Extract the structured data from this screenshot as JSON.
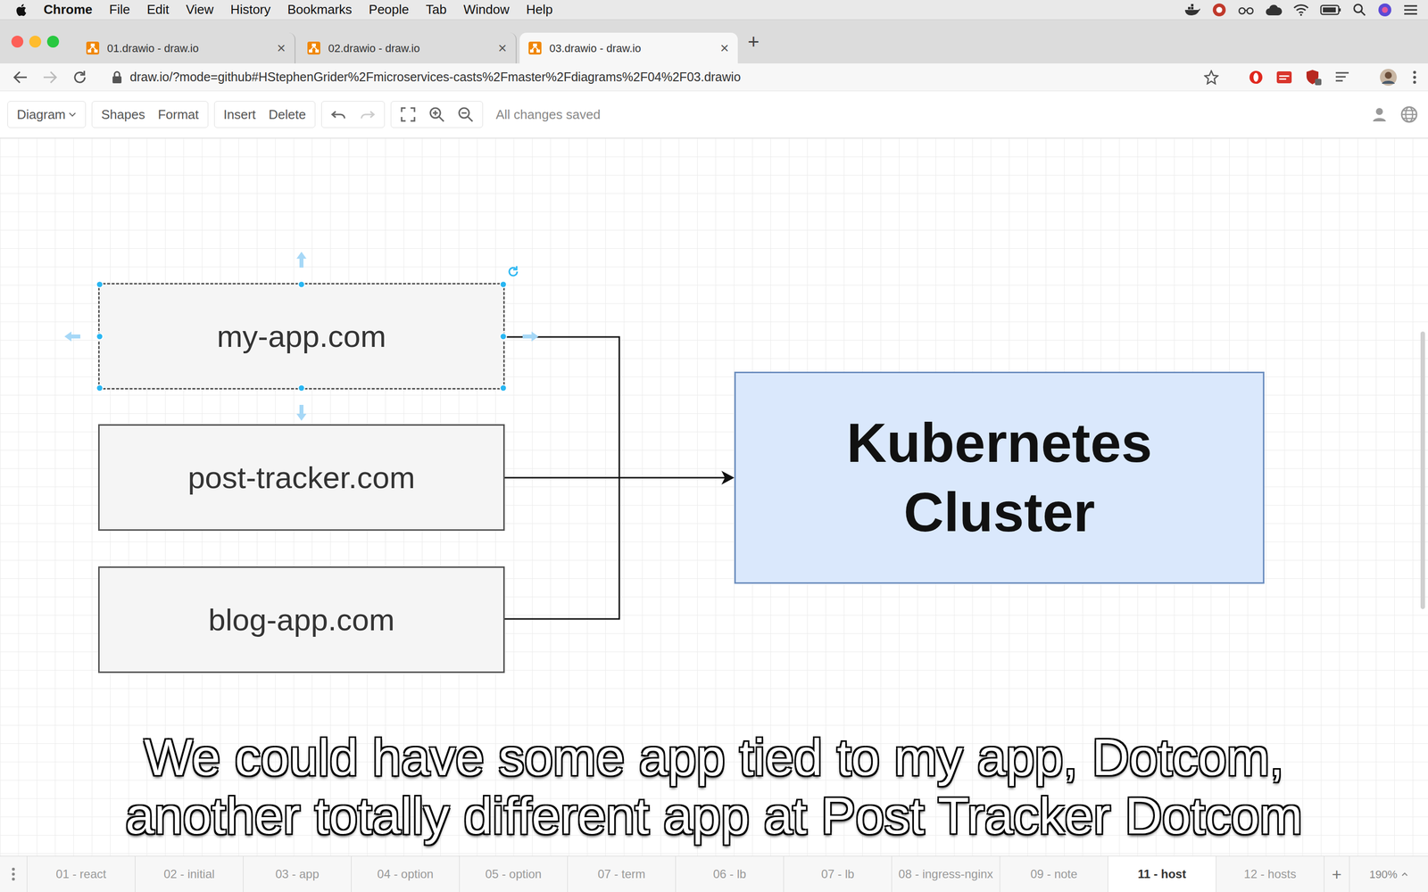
{
  "menu_bar": {
    "app": "Chrome",
    "items": [
      "File",
      "Edit",
      "View",
      "History",
      "Bookmarks",
      "People",
      "Tab",
      "Window",
      "Help"
    ]
  },
  "browser": {
    "tabs": [
      {
        "label": "01.drawio - draw.io",
        "selected": false
      },
      {
        "label": "02.drawio - draw.io",
        "selected": false
      },
      {
        "label": "03.drawio - draw.io",
        "selected": true
      }
    ],
    "tab_close": "×",
    "new_tab": "+",
    "url": "draw.io/?mode=github#HStephenGrider%2Fmicroservices-casts%2Fmaster%2Fdiagrams%2F04%2F03.drawio"
  },
  "toolbar": {
    "diagram_menu": "Diagram",
    "groups": [
      [
        "Shapes",
        "Format"
      ],
      [
        "Insert",
        "Delete"
      ]
    ],
    "history": [
      {
        "kind": "undo",
        "disabled": false
      },
      {
        "kind": "redo",
        "disabled": true
      }
    ],
    "status": "All changes saved"
  },
  "diagram": {
    "nodes": [
      {
        "label": "my-app.com",
        "selected": true
      },
      {
        "label": "post-tracker.com",
        "selected": false
      },
      {
        "label": "blog-app.com",
        "selected": false
      }
    ],
    "cluster": {
      "label": "Kubernetes Cluster"
    }
  },
  "subtitles": [
    "We could have some app tied to my app, Dotcom,",
    "another totally different app at Post Tracker Dotcom"
  ],
  "pages": {
    "tabs": [
      {
        "label": "01 - react",
        "selected": false
      },
      {
        "label": "02 - initial",
        "selected": false
      },
      {
        "label": "03 - app",
        "selected": false
      },
      {
        "label": "04 - option",
        "selected": false
      },
      {
        "label": "05 - option",
        "selected": false
      },
      {
        "label": "07 - term",
        "selected": false
      },
      {
        "label": "06 - lb",
        "selected": false
      },
      {
        "label": "07 - lb",
        "selected": false
      },
      {
        "label": "08 - ingress-nginx",
        "selected": false
      },
      {
        "label": "09 - note",
        "selected": false
      },
      {
        "label": "11 - host",
        "selected": true
      },
      {
        "label": "12 - hosts",
        "selected": false
      }
    ],
    "add": "+",
    "zoom": "190%"
  }
}
